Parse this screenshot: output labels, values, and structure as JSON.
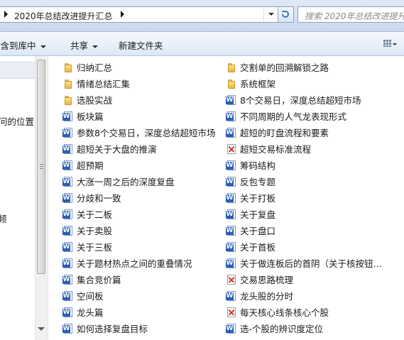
{
  "address": {
    "path": "2020年总结改进提升汇总"
  },
  "search": {
    "placeholder": "搜索 2020年总结改进提升汇总"
  },
  "toolbar": {
    "include_library": "包含到库中",
    "share": "共享",
    "new_folder": "新建文件夹"
  },
  "nav": {
    "items": [
      "问的位置",
      "频"
    ]
  },
  "files": {
    "left": [
      {
        "name": "归纳汇总",
        "type": "folder"
      },
      {
        "name": "情绪总结汇集",
        "type": "folder"
      },
      {
        "name": "选股实战",
        "type": "folder"
      },
      {
        "name": "板块篇",
        "type": "word"
      },
      {
        "name": "参数8个交易日，深度总结超短市场",
        "type": "word"
      },
      {
        "name": "超短关于大盘的推演",
        "type": "word"
      },
      {
        "name": "超预期",
        "type": "word"
      },
      {
        "name": "大涨一周之后的深度复盘",
        "type": "word"
      },
      {
        "name": "分歧和一致",
        "type": "word"
      },
      {
        "name": "关于二板",
        "type": "word"
      },
      {
        "name": "关于卖股",
        "type": "word"
      },
      {
        "name": "关于三板",
        "type": "word"
      },
      {
        "name": "关于题材热点之间的重叠情况",
        "type": "word"
      },
      {
        "name": "集合竞价篇",
        "type": "word"
      },
      {
        "name": "空间板",
        "type": "word"
      },
      {
        "name": "龙头篇",
        "type": "word"
      },
      {
        "name": "如何选择复盘目标",
        "type": "word"
      }
    ],
    "right": [
      {
        "name": "交割单的回溯解锁之路",
        "type": "folder"
      },
      {
        "name": "系统框架",
        "type": "folder"
      },
      {
        "name": "8个交易日，深度总结超短市场",
        "type": "word"
      },
      {
        "name": "不同周期的人气龙表现形式",
        "type": "word"
      },
      {
        "name": "超短的盯盘流程和要素",
        "type": "word"
      },
      {
        "name": "超短交易标准流程",
        "type": "pdf"
      },
      {
        "name": "筹码结构",
        "type": "word"
      },
      {
        "name": "反包专题",
        "type": "word"
      },
      {
        "name": "关于打板",
        "type": "word"
      },
      {
        "name": "关于复盘",
        "type": "word"
      },
      {
        "name": "关于盘口",
        "type": "word"
      },
      {
        "name": "关于首板",
        "type": "word"
      },
      {
        "name": "关于做连板后的首阴（关于核按钮和…",
        "type": "word"
      },
      {
        "name": "交易思路梳理",
        "type": "pdf"
      },
      {
        "name": "龙头股的分时",
        "type": "word"
      },
      {
        "name": "每天核心线条核心个股",
        "type": "pdf"
      },
      {
        "name": "选-个股的辨识度定位",
        "type": "word"
      }
    ]
  }
}
